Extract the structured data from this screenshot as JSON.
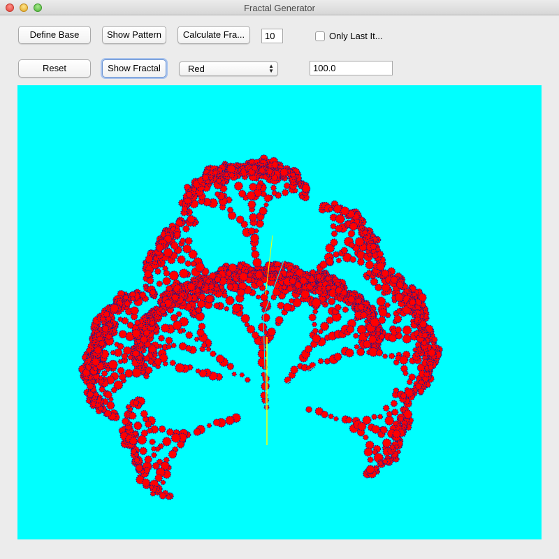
{
  "window": {
    "title": "Fractal Generator"
  },
  "toolbar": {
    "define_base": "Define Base",
    "show_pattern": "Show Pattern",
    "calculate_fractal": "Calculate Fra...",
    "iterations_value": "10",
    "only_last_label": "Only Last It...",
    "only_last_checked": false,
    "reset": "Reset",
    "show_fractal": "Show Fractal",
    "color_selected": "Red",
    "scale_value": "100.0"
  },
  "canvas": {
    "background_color": "#00ffff",
    "fractal_fill_color": "#ff0000",
    "fractal_edge_color": "#1a1a8c",
    "stem_color": "#ffff00",
    "inner_line_color": "#00ffff"
  }
}
